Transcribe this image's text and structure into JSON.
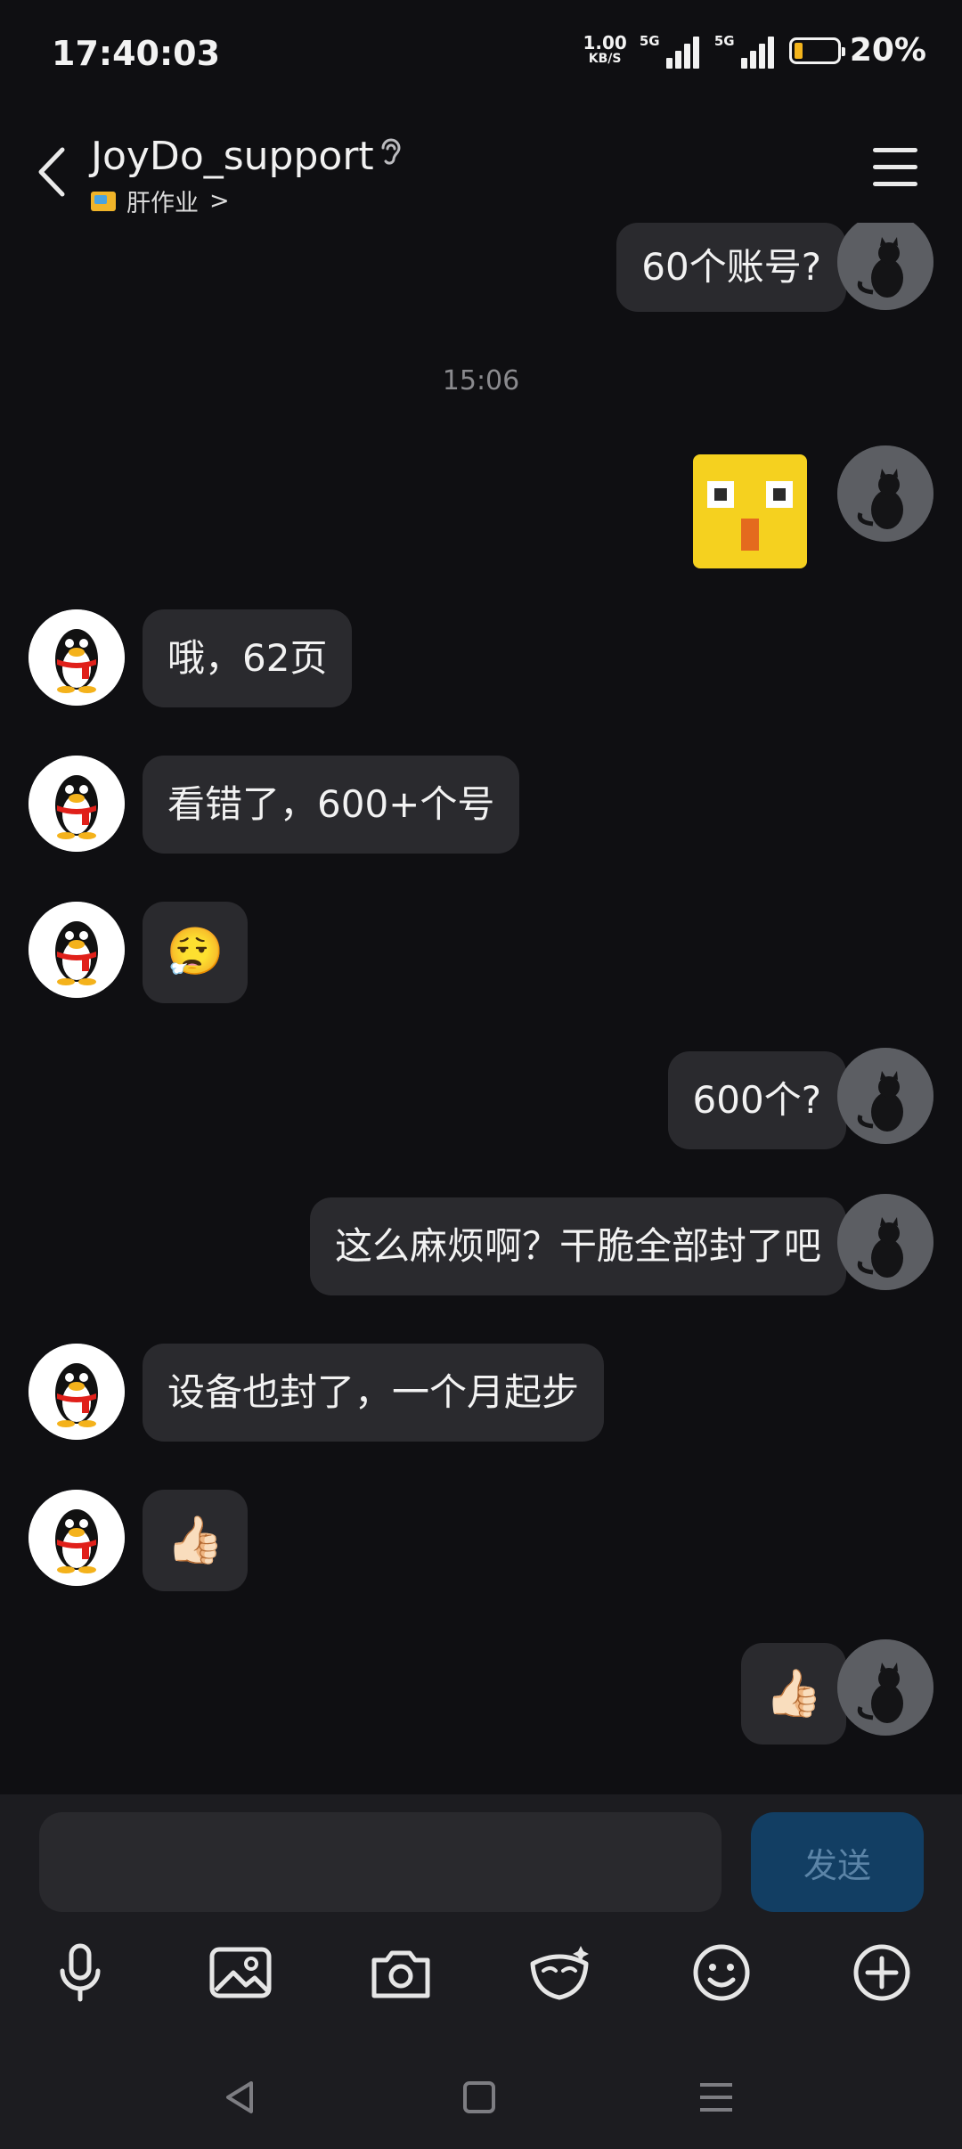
{
  "status_bar": {
    "time": "17:40:03",
    "speed_value": "1.00",
    "speed_unit": "KB/S",
    "sim1_label": "5G",
    "sim2_label": "5G",
    "battery_percent": "20%",
    "battery_level": 0.2,
    "battery_color": "#f3b41c"
  },
  "header": {
    "contact_name": "JoyDo_support",
    "subtitle": "肝作业",
    "subtitle_chevron": ">"
  },
  "messages": [
    {
      "side": "right",
      "type": "text",
      "text": "60个账号?"
    },
    {
      "type": "timestamp",
      "text": "15:06"
    },
    {
      "side": "right",
      "type": "sticker",
      "icon": "yellow-square-surprised-sticker"
    },
    {
      "side": "left",
      "type": "text",
      "text": "哦，62页"
    },
    {
      "side": "left",
      "type": "text",
      "text": "看错了，600+个号"
    },
    {
      "side": "left",
      "type": "emoji",
      "text": "😮‍💨"
    },
    {
      "side": "right",
      "type": "text",
      "text": "600个?"
    },
    {
      "side": "right",
      "type": "text",
      "text": "这么麻烦啊？干脆全部封了吧"
    },
    {
      "side": "left",
      "type": "text",
      "text": "设备也封了，一个月起步"
    },
    {
      "side": "left",
      "type": "emoji",
      "text": "👍🏻"
    },
    {
      "side": "right",
      "type": "emoji",
      "text": "👍🏻"
    }
  ],
  "input": {
    "value": "",
    "send_label": "发送"
  },
  "toolbar_icons": [
    "microphone-icon",
    "image-icon",
    "camera-icon",
    "mask-icon",
    "emoji-icon",
    "plus-icon"
  ],
  "colors": {
    "background": "#0f0f12",
    "bubble": "#2a2a2e",
    "send_button": "#123e63",
    "send_text": "#5b84a7"
  }
}
